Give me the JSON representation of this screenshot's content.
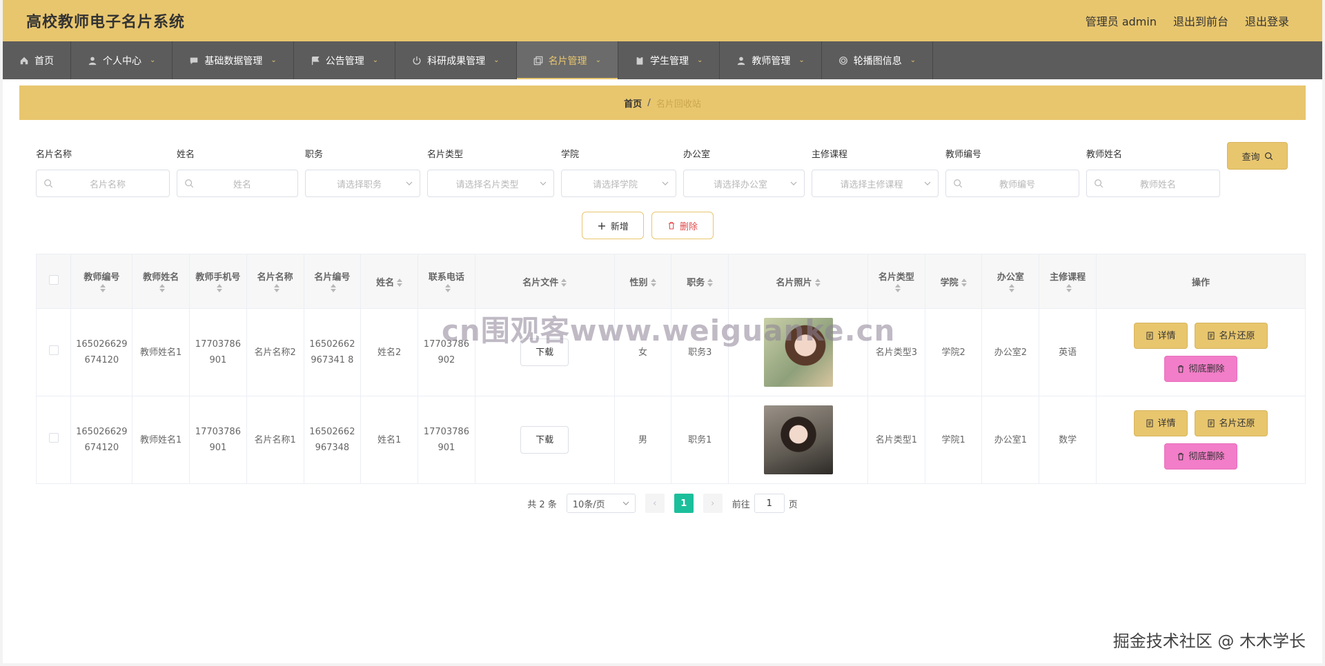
{
  "header": {
    "app_title": "高校教师电子名片系统",
    "links": [
      "管理员 admin",
      "退出到前台",
      "退出登录"
    ]
  },
  "nav": {
    "items": [
      {
        "label": "首页",
        "icon": "home-icon",
        "has_dropdown": false
      },
      {
        "label": "个人中心",
        "icon": "user-icon",
        "has_dropdown": true
      },
      {
        "label": "基础数据管理",
        "icon": "chat-icon",
        "has_dropdown": true
      },
      {
        "label": "公告管理",
        "icon": "flag-icon",
        "has_dropdown": true
      },
      {
        "label": "科研成果管理",
        "icon": "power-icon",
        "has_dropdown": true
      },
      {
        "label": "名片管理",
        "icon": "copy-icon",
        "has_dropdown": true,
        "active": true
      },
      {
        "label": "学生管理",
        "icon": "clipboard-icon",
        "has_dropdown": true
      },
      {
        "label": "教师管理",
        "icon": "user-icon",
        "has_dropdown": true
      },
      {
        "label": "轮播图信息",
        "icon": "circle-icon",
        "has_dropdown": true
      }
    ]
  },
  "breadcrumb": {
    "home": "首页",
    "separator": "/",
    "current": "名片回收站"
  },
  "search": {
    "fields": [
      {
        "label": "名片名称",
        "placeholder": "名片名称",
        "kind": "text"
      },
      {
        "label": "姓名",
        "placeholder": "姓名",
        "kind": "text"
      },
      {
        "label": "职务",
        "placeholder": "请选择职务",
        "kind": "select"
      },
      {
        "label": "名片类型",
        "placeholder": "请选择名片类型",
        "kind": "select"
      },
      {
        "label": "学院",
        "placeholder": "请选择学院",
        "kind": "select"
      },
      {
        "label": "办公室",
        "placeholder": "请选择办公室",
        "kind": "select"
      },
      {
        "label": "主修课程",
        "placeholder": "请选择主修课程",
        "kind": "select"
      },
      {
        "label": "教师编号",
        "placeholder": "教师编号",
        "kind": "text"
      },
      {
        "label": "教师姓名",
        "placeholder": "教师姓名",
        "kind": "text"
      }
    ],
    "query_label": "查询"
  },
  "actions": {
    "add_label": "新增",
    "delete_label": "删除"
  },
  "table": {
    "headers": [
      "教师编号",
      "教师姓名",
      "教师手机号",
      "名片名称",
      "名片编号",
      "姓名",
      "联系电话",
      "名片文件",
      "性别",
      "职务",
      "名片照片",
      "名片类型",
      "学院",
      "办公室",
      "主修课程",
      "操作"
    ],
    "rows": [
      {
        "teacher_no": "165026629674120",
        "teacher_name": "教师姓名1",
        "teacher_phone": "17703786901",
        "card_name": "名片名称2",
        "card_no": "16502662967341 8",
        "name": "姓名2",
        "phone": "17703786902",
        "file_label": "下载",
        "gender": "女",
        "position": "职务3",
        "photo": "portrait-woman-outdoor",
        "card_type": "名片类型3",
        "college": "学院2",
        "office": "办公室2",
        "course": "英语"
      },
      {
        "teacher_no": "165026629674120",
        "teacher_name": "教师姓名1",
        "teacher_phone": "17703786901",
        "card_name": "名片名称1",
        "card_no": "16502662967348",
        "name": "姓名1",
        "phone": "17703786901",
        "file_label": "下载",
        "gender": "男",
        "position": "职务1",
        "photo": "portrait-woman-rocks",
        "card_type": "名片类型1",
        "college": "学院1",
        "office": "办公室1",
        "course": "数学"
      }
    ],
    "op_labels": {
      "detail": "详情",
      "restore": "名片还原",
      "purge": "彻底删除"
    }
  },
  "pagination": {
    "total": "共 2 条",
    "page_size": "10条/页",
    "current_page": "1",
    "goto_prefix": "前往",
    "goto_value": "1",
    "goto_suffix": "页"
  },
  "overlays": {
    "watermark": "cn围观客www.weiguanke.cn",
    "credit": "掘金技术社区 @ 木木学长"
  },
  "colors": {
    "accent": "#e8c66e",
    "nav_bg": "#5c5c5c",
    "purge": "#f27dc8",
    "page_active": "#1cbf9b"
  }
}
